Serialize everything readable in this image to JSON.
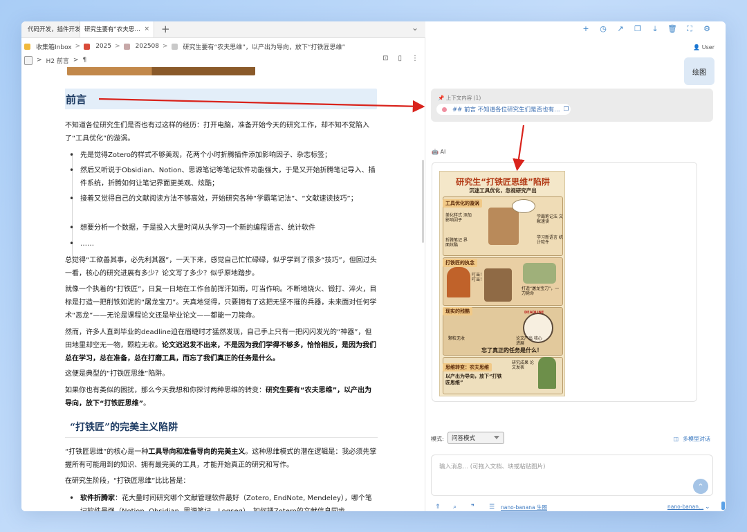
{
  "tabs": [
    {
      "label": "代码开发，插件开发"
    },
    {
      "label": "研究生要有“农夫思…",
      "close": "×"
    }
  ],
  "tab_plus": "+",
  "breadcrumb": {
    "items": [
      "收集箱Inbox",
      "2025",
      "202508",
      "研究生要有“农夫思维”，以产出为导向，放下“打铁匠思维”"
    ],
    "sep": ">"
  },
  "subbar": {
    "heading": "H2 前言",
    "para": "¶"
  },
  "doc": {
    "h2_preface": "前言",
    "p1": "不知道各位研究生们是否也有过这样的经历：打开电脑，准备开始今天的研究工作，却不知不觉陷入了“工具优化”的漩涡。",
    "bullets": [
      "先是觉得Zotero的样式不够美观，花两个小时折腾插件添加影响因子、杂志标签；",
      "然后又听说于Obsidian、Notion、思源笔记等笔记软件功能强大，于是又开始折腾笔记导入、插件系统，折腾如何让笔记界面更美观、炫酷；",
      "接着又觉得自己的文献阅读方法不够高效，开始研究各种“学霸笔记法”、“文献速读技巧”；",
      "想要分析一个数据，于是投入大量时间从头学习一个新的编程语言、统计软件",
      "……"
    ],
    "p2": "总觉得“工欲善其事，必先利其器”，一天下来，感觉自己忙忙碌碌，似乎学到了很多“技巧”，但回过头一看，核心的研究进展有多少？论文写了多少？似乎原地踏步。",
    "p3": "就像一个执着的“打铁匠”，日复一日地在工作台前挥汗如雨，叮当作响。不断地烧火、锻打、淬火，目标是打造一把削铁如泥的“屠龙宝刀”。天真地觉得，只要拥有了这把无坚不摧的兵器，未来面对任何学术“恶龙”——无论是课程论文还是毕业论文——都能一刀毙命。",
    "p4a": "然而，许多人直到毕业的deadline迫在眉睫时才猛然发现，自己手上只有一把闪闪发光的“神器”，但田地里却空无一物，颗粒无收。",
    "p4b": "论文迟迟发不出来，不是因为我们学得不够多，恰恰相反，是因为我们总在学习，总在准备，总在打磨工具，而忘了我们真正的任务是什么。",
    "p5": "这便是典型的“打铁匠思维”陷阱。",
    "p6a": "如果你也有类似的困扰，那么今天我想和你探讨两种思维的转变：",
    "p6b": "研究生要有“农夫思维”，以产出为导向，放下“打铁匠思维”",
    "p6c": "。",
    "h2_trap": "“打铁匠”的完美主义陷阱",
    "p7a": "“打铁匠思维”的核心是一种",
    "p7b": "工具导向和准备导向的完美主义",
    "p7c": "。这种思维模式的潜在逻辑是：我必须先掌握所有可能用到的知识、拥有最完美的工具，才能开始真正的研究和写作。",
    "p8": "在研究生阶段，“打铁匠思维”比比皆是：",
    "b_last_b": "软件折腾家",
    "b_last": "：花大量时间研究哪个文献管理软件最好（Zotero, EndNote, Mendeley），哪个笔记软件最强（Notion, Obsidian, 思源笔记，Logseq），如何把Zotero的文献信息同步"
  },
  "chat": {
    "user_label": "User",
    "user_message": "绘图",
    "context_title": "上下文内容 (1)",
    "context_chip": "## 前言 不知道各位研究生们是否也有…",
    "ai_label": "AI",
    "comic": {
      "title": "研究生“打铁匠思维”陷阱",
      "subtitle": "沉迷工具优化，忽视研究产出",
      "sec1": "工具优化的漩涡",
      "sec1_notes": [
        "美化样式 添加影响因子",
        "学霸笔记法 文献速读",
        "折腾笔记 界面炫酷",
        "学习新语言 统计软件"
      ],
      "sec2": "打铁匠的执念",
      "sec2_notes": [
        "叮当！叮当！",
        "打造“屠龙宝刀”，一刀毙命"
      ],
      "sec3": "现实的残酷",
      "sec3_notes": [
        "DEADLINE",
        "颗粒无收",
        "论文产出 核心进展"
      ],
      "sec3_big": "忘了真正的任务是什么！",
      "sec4": "思维转变：农夫思维",
      "sec4_notes": [
        "研究成果 论文发表"
      ],
      "sec4_big": "以产出为导向，放下“打铁匠思维”"
    },
    "mode_label": "模式:",
    "mode_value": "问答模式",
    "multi_model": "多模型对话",
    "input_placeholder": "输入消息... (可拖入文档、块或粘贴图片)",
    "model_left": "nano-banana 生图",
    "model_right": "nano-banan..."
  },
  "colors": {
    "accent": "#3c84c8",
    "heading": "#1c3a62",
    "arrow": "#d9231c",
    "context_bg": "#ebebeb",
    "user_bubble": "#dde9f6"
  }
}
